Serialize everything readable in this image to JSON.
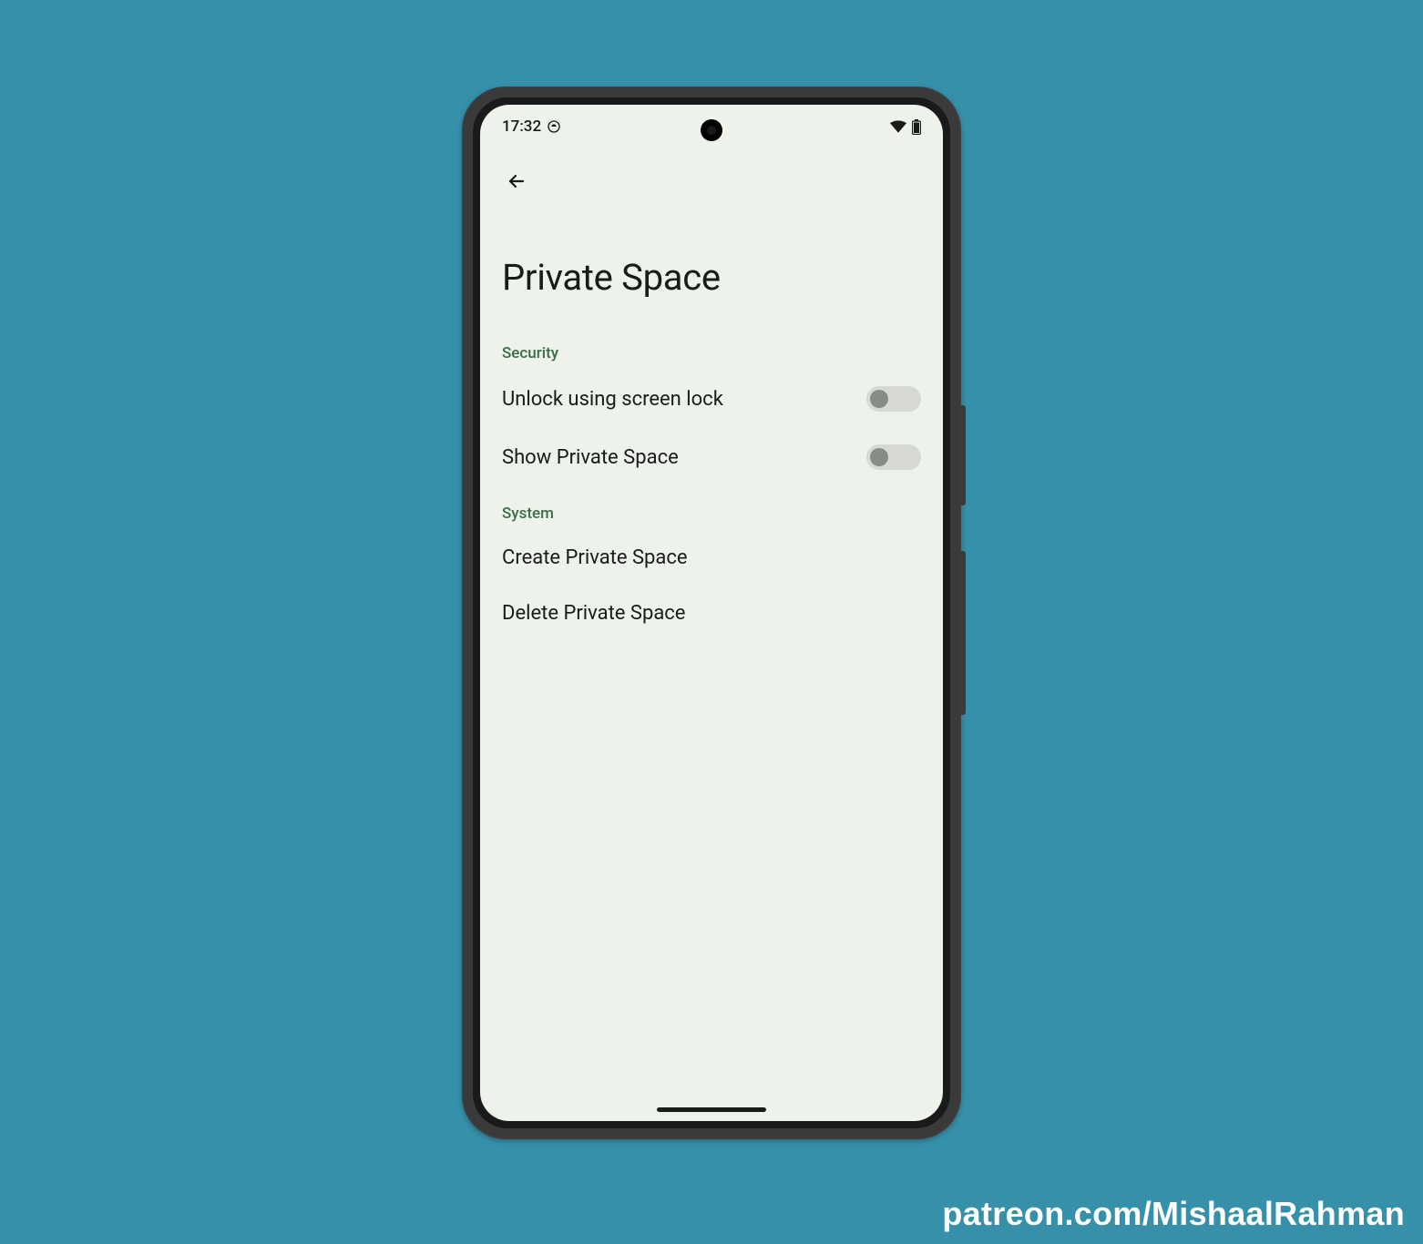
{
  "status": {
    "time": "17:32"
  },
  "page": {
    "title": "Private Space"
  },
  "sections": {
    "security": {
      "header": "Security",
      "items": {
        "unlock": {
          "label": "Unlock using screen lock",
          "toggled": false
        },
        "show": {
          "label": "Show Private Space",
          "toggled": false
        }
      }
    },
    "system": {
      "header": "System",
      "items": {
        "create": {
          "label": "Create Private Space"
        },
        "delete": {
          "label": "Delete Private Space"
        }
      }
    }
  },
  "watermark": "patreon.com/MishaalRahman"
}
